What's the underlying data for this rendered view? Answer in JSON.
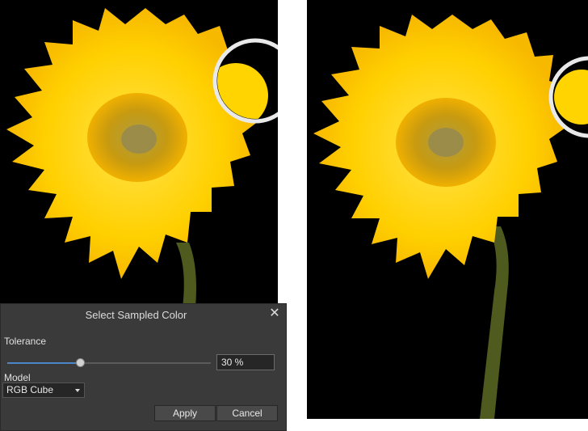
{
  "colors": {
    "canvas_bg": "#000000",
    "petal": "#ffd200",
    "petal_dark": "#f5a800",
    "center": "#a8860a",
    "stem": "#4f5b1e",
    "dialog_bg": "#3a3a3a",
    "slider_accent": "#4c86c8"
  },
  "dialog": {
    "title": "Select Sampled Color",
    "close_glyph": "✕",
    "tolerance_label": "Tolerance",
    "tolerance_value": "30 %",
    "tolerance_fraction": 0.3,
    "model_label": "Model",
    "model_value": "RGB Cube",
    "apply_label": "Apply",
    "cancel_label": "Cancel"
  },
  "icons": {
    "close": "close-icon",
    "dropdown": "chevron-down-icon",
    "magnifier": "magnifier-loupe-icon"
  }
}
